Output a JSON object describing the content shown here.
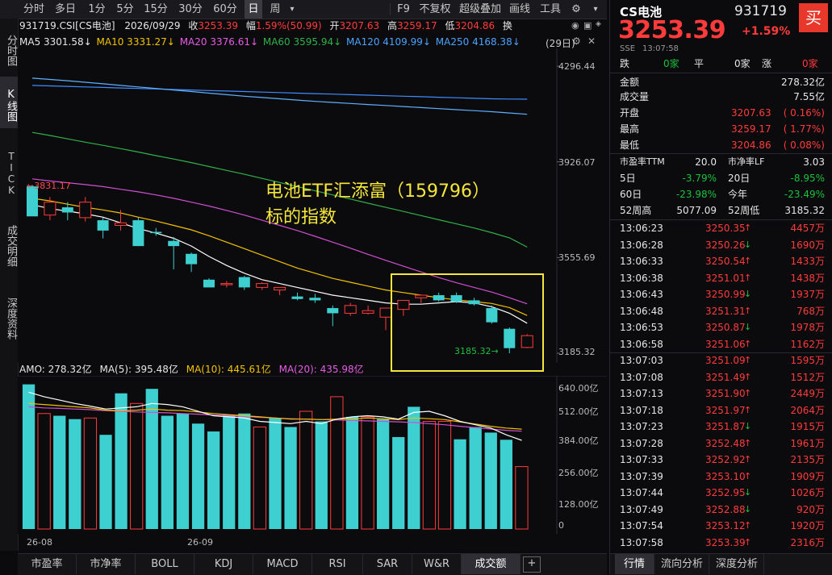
{
  "toolbar": {
    "items": [
      "分时",
      "多日",
      "1分",
      "5分",
      "15分",
      "30分",
      "60分",
      "日",
      "周"
    ],
    "active": "日",
    "right": [
      "F9",
      "不复权",
      "超级叠加",
      "画线",
      "工具"
    ]
  },
  "left_tabs": [
    "分时图",
    "K线图",
    "TICK",
    "成交明细",
    "深度资料"
  ],
  "left_active": "K线图",
  "info": {
    "symbol": "931719.CSI[CS电池]",
    "date": "2026/09/29",
    "close_label": "收",
    "close": "3253.39",
    "amp_label": "幅",
    "amp": "1.59%(50.99)",
    "open_label": "开",
    "open": "3207.63",
    "high_label": "高",
    "high": "3259.17",
    "low_label": "低",
    "low": "3204.86",
    "turnover_label": "换",
    "days": "(29日)"
  },
  "ma": {
    "ma5": "MA5 3301.58↓",
    "ma10": "MA10 3331.27↓",
    "ma20": "MA20 3376.61↓",
    "ma60": "MA60 3595.94↓",
    "ma120": "MA120 4109.99↓",
    "ma250": "MA250 4168.38↓"
  },
  "price_axis": [
    "4296.44",
    "3926.07",
    "3555.69",
    "3185.32"
  ],
  "annot": {
    "max": "3831.17",
    "min": "3185.32"
  },
  "overlay": {
    "line1": "电池ETF汇添富（159796）",
    "line2": "标的指数"
  },
  "vol_info": {
    "amo": "AMO: 278.32亿",
    "ma5": "MA(5): 395.48亿",
    "ma10": "MA(10): 445.61亿",
    "ma20": "MA(20): 435.98亿"
  },
  "vol_axis": [
    "640.00亿",
    "512.00亿",
    "384.00亿",
    "256.00亿",
    "128.00亿",
    "0"
  ],
  "x_axis": [
    "26-08",
    "26-09"
  ],
  "bottom_tabs": [
    "市盈率",
    "市净率",
    "BOLL",
    "KDJ",
    "MACD",
    "RSI",
    "SAR",
    "W&R",
    "成交额"
  ],
  "bottom_active": "成交额",
  "quote": {
    "name": "CS电池",
    "code": "931719",
    "buy": "买",
    "price": "3253.39",
    "change_pct": "+1.59%",
    "exchange": "SSE",
    "time": "13:07:58",
    "up_label": "跌",
    "up_count": "0家",
    "flat_label": "平",
    "flat_count": "0家",
    "down_label": "涨",
    "down_count": "0家",
    "amount_label": "金额",
    "amount": "278.32亿",
    "volume_label": "成交量",
    "volume": "7.55亿",
    "open_label": "开盘",
    "open": "3207.63",
    "open_pct": "( 0.16%)",
    "high_label": "最高",
    "high": "3259.17",
    "high_pct": "( 1.77%)",
    "low_label": "最低",
    "low": "3204.86",
    "low_pct": "( 0.08%)",
    "pe_label": "市盈率TTM",
    "pe": "20.0",
    "pb_label": "市净率LF",
    "pb": "3.03",
    "d5_label": "5日",
    "d5": "-3.79%",
    "d20_label": "20日",
    "d20": "-8.95%",
    "d60_label": "60日",
    "d60": "-23.98%",
    "ytd_label": "今年",
    "ytd": "-23.49%",
    "w52h_label": "52周高",
    "w52h": "5077.09",
    "w52l_label": "52周低",
    "w52l": "3185.32"
  },
  "ticks": [
    {
      "time": "13:06:23",
      "price": "3250.35",
      "dir": "up",
      "vol": "4457万"
    },
    {
      "time": "13:06:28",
      "price": "3250.26",
      "dir": "down",
      "vol": "1690万"
    },
    {
      "time": "13:06:33",
      "price": "3250.54",
      "dir": "up",
      "vol": "1433万"
    },
    {
      "time": "13:06:38",
      "price": "3251.01",
      "dir": "up",
      "vol": "1438万"
    },
    {
      "time": "13:06:43",
      "price": "3250.99",
      "dir": "down",
      "vol": "1937万"
    },
    {
      "time": "13:06:48",
      "price": "3251.31",
      "dir": "up",
      "vol": "768万"
    },
    {
      "time": "13:06:53",
      "price": "3250.87",
      "dir": "down",
      "vol": "1978万"
    },
    {
      "time": "13:06:58",
      "price": "3251.06",
      "dir": "up",
      "vol": "1162万"
    },
    {
      "time": "13:07:03",
      "price": "3251.09",
      "dir": "up",
      "vol": "1595万"
    },
    {
      "time": "13:07:08",
      "price": "3251.49",
      "dir": "up",
      "vol": "1512万"
    },
    {
      "time": "13:07:13",
      "price": "3251.90",
      "dir": "up",
      "vol": "2449万"
    },
    {
      "time": "13:07:18",
      "price": "3251.97",
      "dir": "up",
      "vol": "2064万"
    },
    {
      "time": "13:07:23",
      "price": "3251.87",
      "dir": "down",
      "vol": "1915万"
    },
    {
      "time": "13:07:28",
      "price": "3252.48",
      "dir": "up",
      "vol": "1961万"
    },
    {
      "time": "13:07:33",
      "price": "3252.92",
      "dir": "up",
      "vol": "2135万"
    },
    {
      "time": "13:07:39",
      "price": "3253.10",
      "dir": "up",
      "vol": "1909万"
    },
    {
      "time": "13:07:44",
      "price": "3252.95",
      "dir": "down",
      "vol": "1026万"
    },
    {
      "time": "13:07:49",
      "price": "3252.88",
      "dir": "down",
      "vol": "920万"
    },
    {
      "time": "13:07:54",
      "price": "3253.12",
      "dir": "up",
      "vol": "1920万"
    },
    {
      "time": "13:07:58",
      "price": "3253.39",
      "dir": "up",
      "vol": "2316万"
    }
  ],
  "right_tabs": [
    "行情",
    "流向分析",
    "深度分析"
  ],
  "right_active": "行情",
  "chart_data": {
    "type": "candlestick",
    "ylim": [
      3185.32,
      4296.44
    ],
    "candles": [
      {
        "o": 3831,
        "h": 3836,
        "l": 3720,
        "c": 3715
      },
      {
        "o": 3720,
        "h": 3790,
        "l": 3700,
        "c": 3770
      },
      {
        "o": 3750,
        "h": 3770,
        "l": 3700,
        "c": 3730
      },
      {
        "o": 3710,
        "h": 3790,
        "l": 3695,
        "c": 3770
      },
      {
        "o": 3700,
        "h": 3710,
        "l": 3630,
        "c": 3660
      },
      {
        "o": 3680,
        "h": 3740,
        "l": 3660,
        "c": 3690
      },
      {
        "o": 3700,
        "h": 3710,
        "l": 3600,
        "c": 3600
      },
      {
        "o": 3655,
        "h": 3670,
        "l": 3640,
        "c": 3650
      },
      {
        "o": 3620,
        "h": 3635,
        "l": 3510,
        "c": 3600
      },
      {
        "o": 3570,
        "h": 3575,
        "l": 3500,
        "c": 3530
      },
      {
        "o": 3470,
        "h": 3475,
        "l": 3440,
        "c": 3440
      },
      {
        "o": 3455,
        "h": 3465,
        "l": 3440,
        "c": 3455
      },
      {
        "o": 3480,
        "h": 3485,
        "l": 3430,
        "c": 3440
      },
      {
        "o": 3440,
        "h": 3460,
        "l": 3430,
        "c": 3455
      },
      {
        "o": 3430,
        "h": 3440,
        "l": 3410,
        "c": 3440
      },
      {
        "o": 3405,
        "h": 3420,
        "l": 3390,
        "c": 3395
      },
      {
        "o": 3400,
        "h": 3415,
        "l": 3380,
        "c": 3390
      },
      {
        "o": 3360,
        "h": 3370,
        "l": 3290,
        "c": 3340
      },
      {
        "o": 3340,
        "h": 3380,
        "l": 3330,
        "c": 3370
      },
      {
        "o": 3340,
        "h": 3370,
        "l": 3335,
        "c": 3350
      },
      {
        "o": 3325,
        "h": 3355,
        "l": 3275,
        "c": 3360
      },
      {
        "o": 3355,
        "h": 3365,
        "l": 3330,
        "c": 3390
      },
      {
        "o": 3400,
        "h": 3410,
        "l": 3380,
        "c": 3410
      },
      {
        "o": 3410,
        "h": 3420,
        "l": 3385,
        "c": 3390
      },
      {
        "o": 3410,
        "h": 3420,
        "l": 3380,
        "c": 3385
      },
      {
        "o": 3390,
        "h": 3400,
        "l": 3370,
        "c": 3375
      },
      {
        "o": 3360,
        "h": 3370,
        "l": 3300,
        "c": 3305
      },
      {
        "o": 3280,
        "h": 3285,
        "l": 3185,
        "c": 3205
      },
      {
        "o": 3207.63,
        "h": 3259.17,
        "l": 3204.86,
        "c": 3253.39
      }
    ],
    "ma5": [
      3760,
      3745,
      3735,
      3725,
      3712,
      3690,
      3668,
      3650,
      3630,
      3600,
      3560,
      3525,
      3495,
      3470,
      3455,
      3440,
      3425,
      3410,
      3400,
      3390,
      3380,
      3375,
      3375,
      3380,
      3385,
      3380,
      3365,
      3340,
      3301.58
    ],
    "ma10": [
      3785,
      3775,
      3762,
      3750,
      3740,
      3728,
      3712,
      3697,
      3680,
      3663,
      3640,
      3615,
      3590,
      3565,
      3540,
      3515,
      3495,
      3475,
      3460,
      3445,
      3430,
      3420,
      3410,
      3400,
      3392,
      3385,
      3378,
      3362,
      3331.27
    ],
    "ma20": [
      3860,
      3852,
      3845,
      3838,
      3830,
      3820,
      3810,
      3798,
      3785,
      3770,
      3755,
      3738,
      3720,
      3700,
      3680,
      3660,
      3638,
      3615,
      3592,
      3568,
      3545,
      3522,
      3500,
      3478,
      3458,
      3440,
      3422,
      3400,
      3376.61
    ],
    "ma60": [
      4040,
      4028,
      4015,
      4002,
      3990,
      3977,
      3964,
      3950,
      3937,
      3923,
      3908,
      3893,
      3878,
      3862,
      3846,
      3830,
      3814,
      3798,
      3782,
      3766,
      3750,
      3734,
      3718,
      3702,
      3686,
      3670,
      3652,
      3632,
      3595.94
    ],
    "ma120": [
      4250,
      4245,
      4240,
      4234,
      4228,
      4222,
      4216,
      4210,
      4204,
      4198,
      4192,
      4186,
      4180,
      4175,
      4170,
      4165,
      4160,
      4156,
      4152,
      4148,
      4144,
      4140,
      4136,
      4132,
      4128,
      4124,
      4120,
      4115,
      4109.99
    ],
    "ma250": [
      4222,
      4220,
      4218,
      4216,
      4214,
      4212,
      4210,
      4208,
      4206,
      4204,
      4202,
      4200,
      4198,
      4196,
      4194,
      4192,
      4190,
      4188,
      4186,
      4184,
      4182,
      4180,
      4178,
      4176,
      4174,
      4172,
      4170,
      4169,
      4168.38
    ],
    "volumes": [
      645,
      515,
      505,
      490,
      495,
      420,
      605,
      560,
      625,
      505,
      515,
      470,
      435,
      510,
      515,
      455,
      495,
      455,
      525,
      480,
      590,
      500,
      500,
      490,
      410,
      545,
      480,
      480,
      400,
      455,
      430,
      398,
      278.32
    ],
    "vol_up": [
      false,
      true,
      false,
      false,
      true,
      false,
      false,
      true,
      false,
      false,
      false,
      false,
      false,
      false,
      false,
      true,
      false,
      false,
      true,
      false,
      true,
      false,
      true,
      false,
      false,
      false,
      true,
      true,
      false,
      false,
      false,
      false,
      true
    ],
    "amo_ma5": [
      610,
      590,
      575,
      560,
      548,
      535,
      540,
      545,
      560,
      555,
      545,
      525,
      505,
      500,
      495,
      480,
      475,
      470,
      480,
      470,
      490,
      500,
      505,
      500,
      490,
      520,
      525,
      505,
      480,
      465,
      450,
      420,
      395.48
    ],
    "amo_ma10": [
      560,
      555,
      550,
      545,
      540,
      530,
      528,
      530,
      535,
      530,
      528,
      522,
      515,
      510,
      505,
      500,
      495,
      490,
      490,
      488,
      490,
      490,
      495,
      492,
      488,
      495,
      492,
      488,
      478,
      468,
      458,
      450,
      445.61
    ],
    "amo_ma20": [
      545,
      540,
      538,
      535,
      532,
      528,
      525,
      522,
      520,
      518,
      515,
      512,
      508,
      505,
      502,
      498,
      495,
      492,
      490,
      488,
      486,
      484,
      482,
      480,
      478,
      475,
      470,
      465,
      458,
      452,
      446,
      440,
      435.98
    ]
  }
}
